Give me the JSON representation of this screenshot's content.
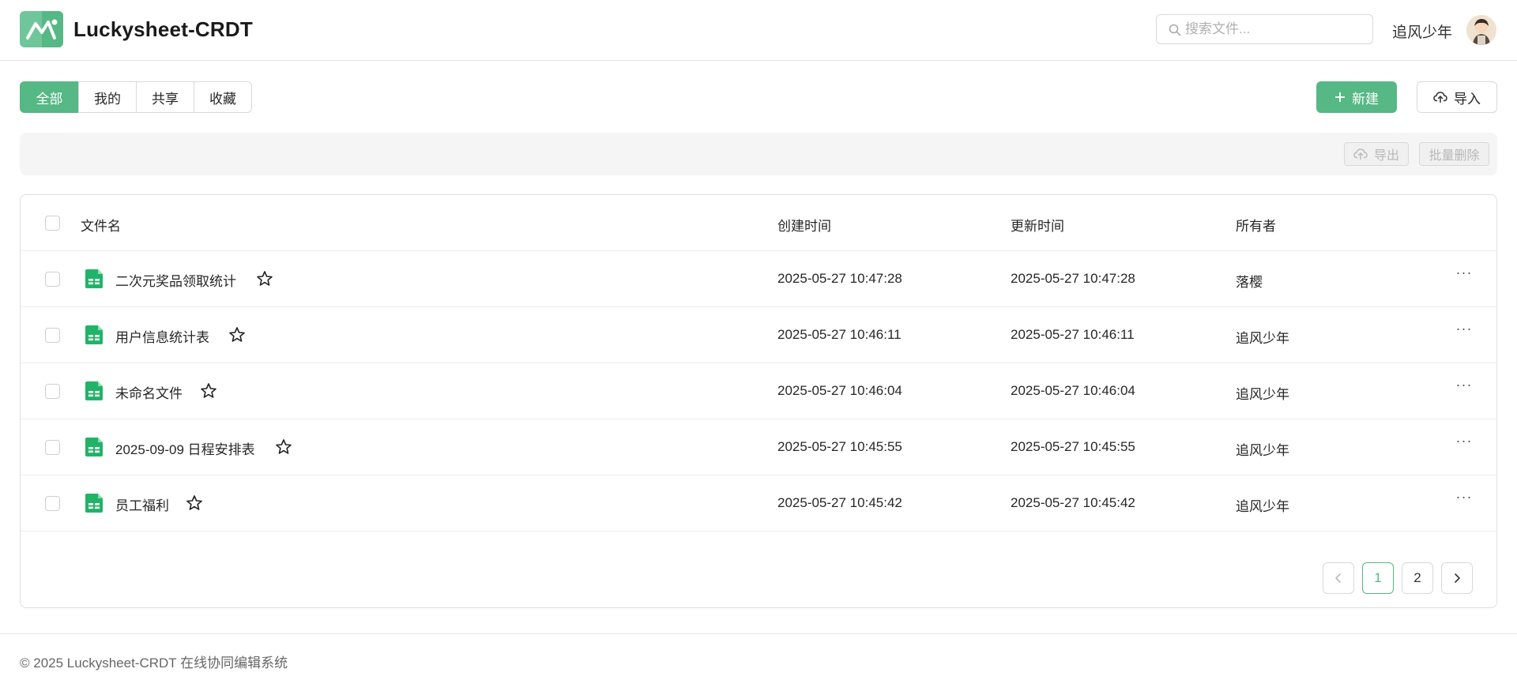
{
  "header": {
    "app_title": "Luckysheet-CRDT",
    "search_placeholder": "搜索文件...",
    "username": "追风少年"
  },
  "tabs": [
    "全部",
    "我的",
    "共享",
    "收藏"
  ],
  "actions": {
    "new_label": "新建",
    "import_label": "导入"
  },
  "toolbar": {
    "export_label": "导出",
    "bulk_delete_label": "批量删除"
  },
  "table": {
    "columns": {
      "name": "文件名",
      "created": "创建时间",
      "updated": "更新时间",
      "owner": "所有者"
    },
    "rows": [
      {
        "name": "二次元奖品领取统计",
        "created": "2025-05-27 10:47:28",
        "updated": "2025-05-27 10:47:28",
        "owner": "落樱"
      },
      {
        "name": "用户信息统计表",
        "created": "2025-05-27 10:46:11",
        "updated": "2025-05-27 10:46:11",
        "owner": "追风少年"
      },
      {
        "name": "未命名文件",
        "created": "2025-05-27 10:46:04",
        "updated": "2025-05-27 10:46:04",
        "owner": "追风少年"
      },
      {
        "name": "2025-09-09 日程安排表",
        "created": "2025-05-27 10:45:55",
        "updated": "2025-05-27 10:45:55",
        "owner": "追风少年"
      },
      {
        "name": "员工福利",
        "created": "2025-05-27 10:45:42",
        "updated": "2025-05-27 10:45:42",
        "owner": "追风少年"
      }
    ],
    "more_label": "···"
  },
  "pagination": {
    "pages": [
      "1",
      "2"
    ],
    "current": "1"
  },
  "footer": {
    "text": "© 2025 Luckysheet-CRDT 在线协同编辑系统"
  },
  "colors": {
    "accent": "#55b885",
    "sheet_icon": "#1fb468"
  }
}
